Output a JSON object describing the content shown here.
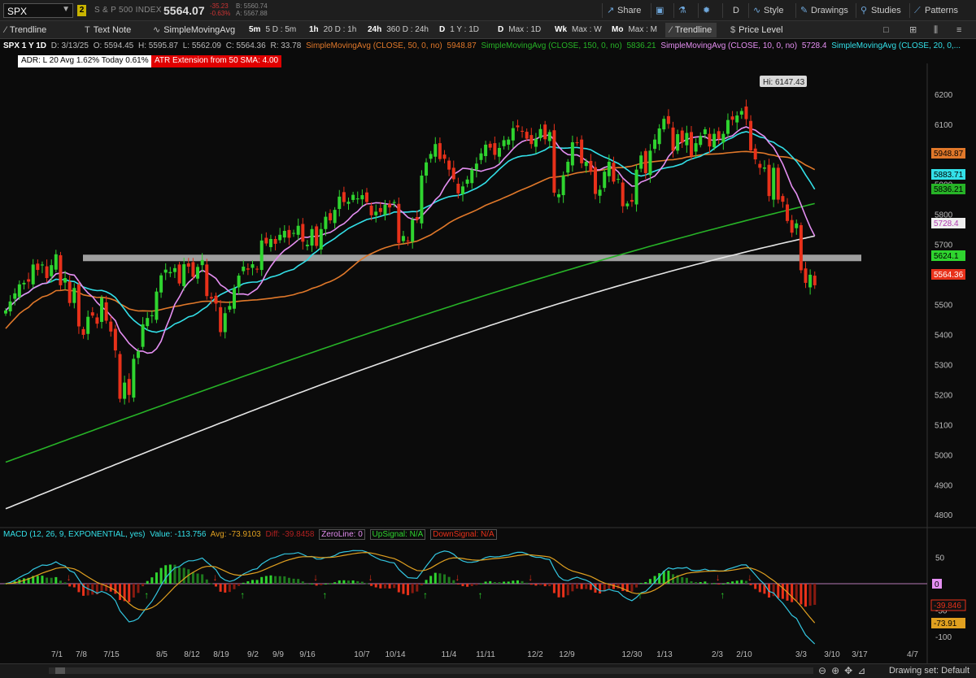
{
  "header": {
    "symbol": "SPX",
    "link_badge": "2",
    "index_name": "S & P 500 INDEX",
    "last_price": "5564.07",
    "change": "-35.23",
    "change_pct": "-0.63%",
    "bid": "B: 5560.74",
    "ask": "A: 5567.88",
    "share_label": "Share",
    "aggregation_label": "D",
    "style_label": "Style",
    "drawings_label": "Drawings",
    "studies_label": "Studies",
    "patterns_label": "Patterns"
  },
  "toolbar": {
    "trendline_label": "Trendline",
    "textnote_label": "Text Note",
    "sma_label": "SimpleMovingAvg",
    "timeframes": [
      {
        "key": "5m",
        "label": "5 D : 5m"
      },
      {
        "key": "1h",
        "label": "20 D : 1h"
      },
      {
        "key": "24h",
        "label": "360 D : 24h"
      },
      {
        "key": "D",
        "label": "1 Y : 1D"
      },
      {
        "key": "D",
        "label": "Max : 1D"
      },
      {
        "key": "Wk",
        "label": "Max : W"
      },
      {
        "key": "Mo",
        "label": "Max : M"
      }
    ],
    "active_tool_label": "Trendline",
    "price_level_label": "Price Level"
  },
  "studies": {
    "title": "SPX 1 Y 1D",
    "date": "D: 3/13/25",
    "open": "O: 5594.45",
    "high": "H: 5595.87",
    "low": "L: 5562.09",
    "close": "C: 5564.36",
    "range": "R: 33.78",
    "sma50": "SimpleMovingAvg (CLOSE, 50, 0, no)",
    "sma50_val": "5948.87",
    "sma150": "SimpleMovingAvg (CLOSE, 150, 0, no)",
    "sma150_val": "5836.21",
    "sma10": "SimpleMovingAvg (CLOSE, 10, 0, no)",
    "sma10_val": "5728.4",
    "sma20": "SimpleMovingAvg (CLOSE, 20, 0,...",
    "adr_text": "ADR: L 20  Avg 1.62%  Today 0.61%",
    "atr_text": "ATR Extension from 50 SMA: 4.00"
  },
  "macd": {
    "title": "MACD (12, 26, 9, EXPONENTIAL, yes)",
    "value": "Value: -113.756",
    "avg": "Avg: -73.9103",
    "diff": "Diff: -39.8458",
    "zeroline": "ZeroLine: 0",
    "upsignal": "UpSignal: N/A",
    "downsignal": "DownSignal: N/A"
  },
  "status": {
    "drawing_set": "Drawing set: Default"
  },
  "colors": {
    "up": "#2fd42f",
    "down": "#e8311a",
    "sma10": "#e58ff2",
    "sma20": "#33e0e8",
    "sma50": "#e0782a",
    "sma150": "#27b327",
    "sma200": "#e6e6e6",
    "level": "#a0a0a0"
  },
  "chart_data": {
    "type": "candlestick",
    "title": "SPX 1 Y 1D",
    "xlabel": "",
    "ylabel": "",
    "ylim": [
      4760,
      6270
    ],
    "y_ticks": [
      4800,
      4900,
      5000,
      5100,
      5200,
      5300,
      5400,
      5500,
      5600,
      5700,
      5800,
      5900,
      6000,
      6100,
      6200
    ],
    "x_ticks": [
      "7/1",
      "7/8",
      "7/15",
      "8/5",
      "8/12",
      "8/19",
      "9/2",
      "9/9",
      "9/16",
      "10/7",
      "10/14",
      "11/4",
      "11/11",
      "12/2",
      "12/9",
      "12/30",
      "1/13",
      "2/3",
      "2/10",
      "3/3",
      "3/10",
      "3/17",
      "4/7"
    ],
    "annotations": {
      "high_label": "Hi: 6147.43",
      "price_level": 5655,
      "last_labels": [
        {
          "value": 5948.87,
          "label": "5948.87"
        },
        {
          "value": 5883.71,
          "label": "5883.71"
        },
        {
          "value": 5836.21,
          "label": "5836.21"
        },
        {
          "value": 5728.4,
          "label": "5728.4"
        },
        {
          "value": 5624.1,
          "label": "5624.1"
        },
        {
          "value": 5564.36,
          "label": "5564.36"
        }
      ]
    },
    "closes": [
      5480,
      5510,
      5537,
      5567,
      5572,
      5576,
      5633,
      5615,
      5633,
      5588,
      5631,
      5667,
      5564,
      5588,
      5505,
      5555,
      5427,
      5399,
      5459,
      5463,
      5436,
      5522,
      5446,
      5410,
      5347,
      5186,
      5240,
      5199,
      5319,
      5344,
      5434,
      5455,
      5464,
      5543,
      5597,
      5616,
      5608,
      5621,
      5570,
      5634,
      5626,
      5592,
      5625,
      5648,
      5528,
      5520,
      5503,
      5408,
      5471,
      5495,
      5554,
      5596,
      5626,
      5616,
      5634,
      5618,
      5713,
      5703,
      5718,
      5702,
      5732,
      5745,
      5722,
      5738,
      5762,
      5709,
      5699,
      5751,
      5695,
      5751,
      5792,
      5780,
      5815,
      5859,
      5841,
      5842,
      5865,
      5853,
      5864,
      5841,
      5797,
      5809,
      5808,
      5832,
      5823,
      5841,
      5705,
      5728,
      5712,
      5782,
      5782,
      5929,
      5973,
      6001,
      6034,
      5984,
      5985,
      5949,
      5917,
      5870,
      5893,
      5916,
      5949,
      5969,
      6003,
      6032,
      6022,
      5998,
      6021,
      6047,
      6049,
      6087,
      6090,
      6075,
      6052,
      6034,
      6051,
      6084,
      6050,
      6074,
      5872,
      5867,
      5930,
      5975,
      6040,
      6037,
      5970,
      5975,
      5942,
      5868,
      5882,
      5942,
      5975,
      5909,
      5918,
      5827,
      5836,
      5842,
      5949,
      5996,
      5937,
      6012,
      6049,
      6086,
      6118,
      6101,
      6012,
      6067,
      6039,
      6071,
      5994,
      6037,
      6061,
      6083,
      6026,
      6068,
      6051,
      6068,
      6114,
      6115,
      6129,
      6144,
      6117,
      6013,
      5983,
      5955,
      5956,
      5861,
      5955,
      5849,
      5842,
      5778,
      5739,
      5770,
      5614,
      5572,
      5599,
      5564
    ],
    "series": [
      {
        "name": "SMA 10",
        "last": 5728.4
      },
      {
        "name": "SMA 20",
        "last": 5883.71
      },
      {
        "name": "SMA 50",
        "last": 5948.87
      },
      {
        "name": "SMA 150",
        "last": 5836.21
      },
      {
        "name": "SMA 200",
        "last": 5728.4
      }
    ],
    "macd_panel": {
      "type": "line",
      "ylim": [
        -120,
        80
      ],
      "y_ticks": [
        -100,
        -50,
        0,
        50
      ],
      "zero_label": "0",
      "last_labels": [
        {
          "value": -39.846,
          "label": "-39.846"
        },
        {
          "value": -73.91,
          "label": "-73.91"
        },
        {
          "value": -113.756,
          "label": "-113.756"
        }
      ]
    }
  }
}
